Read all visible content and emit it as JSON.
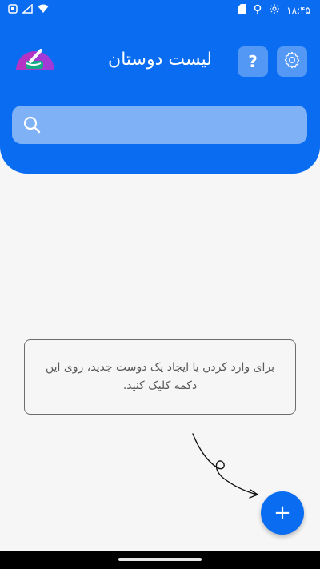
{
  "status_bar": {
    "time": "۱۸:۴۵",
    "left_icons": [
      "notification-icon",
      "signal-icon",
      "wifi-icon"
    ],
    "right_icons": [
      "sd-card-icon",
      "location-icon",
      "settings-gear-icon"
    ]
  },
  "header": {
    "title": "لیست دوستان",
    "help_label": "?",
    "bg_color": "#0a6cf0"
  },
  "search": {
    "placeholder": "",
    "value": ""
  },
  "empty_state": {
    "hint": "برای وارد کردن یا ایجاد یک دوست جدید، روی این دکمه کلیک کنید."
  },
  "fab": {
    "label": "+"
  },
  "colors": {
    "accent": "#0a6cf0",
    "background": "#f6f6f6"
  }
}
